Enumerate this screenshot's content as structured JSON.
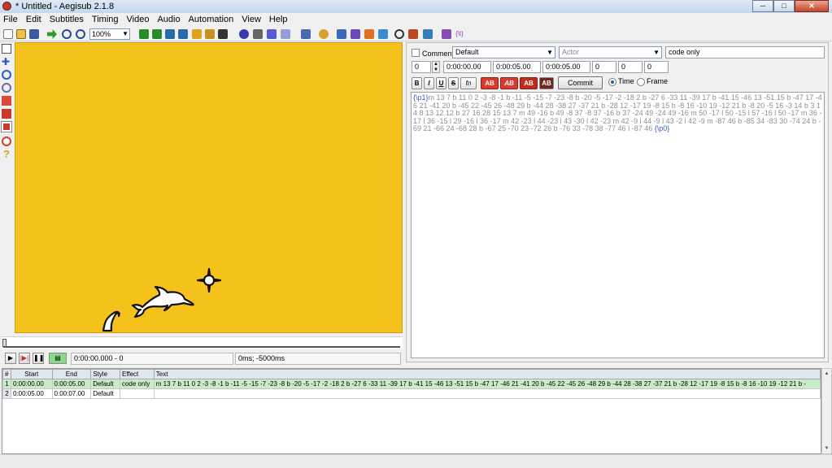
{
  "window": {
    "title": "* Untitled - Aegisub 2.1.8"
  },
  "menu": [
    "File",
    "Edit",
    "Subtitles",
    "Timing",
    "Video",
    "Audio",
    "Automation",
    "View",
    "Help"
  ],
  "toolbar": {
    "zoom": "100%"
  },
  "video": {
    "time_display": "0:00:00.000 - 0",
    "offset_display": "0ms; -5000ms"
  },
  "editbox": {
    "comment_label": "Comment",
    "style": "Default",
    "actor_placeholder": "Actor",
    "effect": "code only",
    "layer": "0",
    "start": "0:00:00.00",
    "end": "0:00:05.00",
    "duration": "0:00:05.00",
    "margin_l": "0",
    "margin_r": "0",
    "margin_v": "0",
    "bold_label": "B",
    "italic_label": "I",
    "underline_label": "U",
    "strike_label": "S",
    "fn_label": "fn",
    "color1_label": "AB",
    "color2_label": "AB",
    "color3_label": "AB",
    "color4_label": "AB",
    "commit_label": "Commit",
    "time_label": "Time",
    "frame_label": "Frame",
    "text_open_tag": "{\\p1}",
    "text_body": "m 13 7 b 11 0 2 -3 -8 -1 b -11 -5 -15 -7 -23 -8 b -20 -5 -17 -2 -18 2 b -27 6 -33 11 -39 17 b -41 15 -46 13 -51 15 b -47 17 -46 21 -41 20 b -45 22 -45 26 -48 29 b -44 28 -38 27 -37 21 b -28 12 -17 19 -8 15 b -8 16 -10 19 -12 21 b -8 20 -5 16 -3 14 b 3 14 8 13 12 12 b 27 16 28 15 13 7 m 49 -16 b 49 -8 37 -8 37 -16 b 37 -24 49 -24 49 -16 m 50 -17 l 50 -15 l 57 -16 l 50 -17 m 36 -17 l 36 -15 l 29 -16 l 36 -17 m 42 -23 l 44 -23 l 43 -30 l 42 -23 m 42 -9 l 44 -9 l 43 -2 l 42 -9 m -87 46 b -85 34 -83 30 -74 24 b -69 21 -66 24 -68 28 b -67 25 -70 23 -72 26 b -76 33 -78 38 -77 46 l -87 46 ",
    "text_close_tag": "{\\p0}"
  },
  "grid": {
    "headers": [
      "#",
      "Start",
      "End",
      "Style",
      "Effect",
      "Text"
    ],
    "rows": [
      {
        "num": "1",
        "start": "0:00:00.00",
        "end": "0:00:05.00",
        "style": "Default",
        "effect": "code only",
        "text": "m 13 7 b 11 0 2 -3 -8 -1 b -11 -5 -15 -7 -23 -8 b -20 -5 -17 -2 -18 2 b -27 6 -33 11 -39 17 b -41 15 -46 13 -51 15 b -47 17 -46 21 -41 20 b -45 22 -45 26 -48 29 b -44 28 -38 27 -37 21 b -28 12 -17 19 -8 15 b -8 16 -10 19 -12 21 b -"
      },
      {
        "num": "2",
        "start": "0:00:05.00",
        "end": "0:00:07.00",
        "style": "Default",
        "effect": "",
        "text": ""
      }
    ]
  },
  "colors": {
    "video_bg": "#f4c21b",
    "selected_row": "#c8ecc8",
    "tag_blue": "#3b5dc9"
  }
}
